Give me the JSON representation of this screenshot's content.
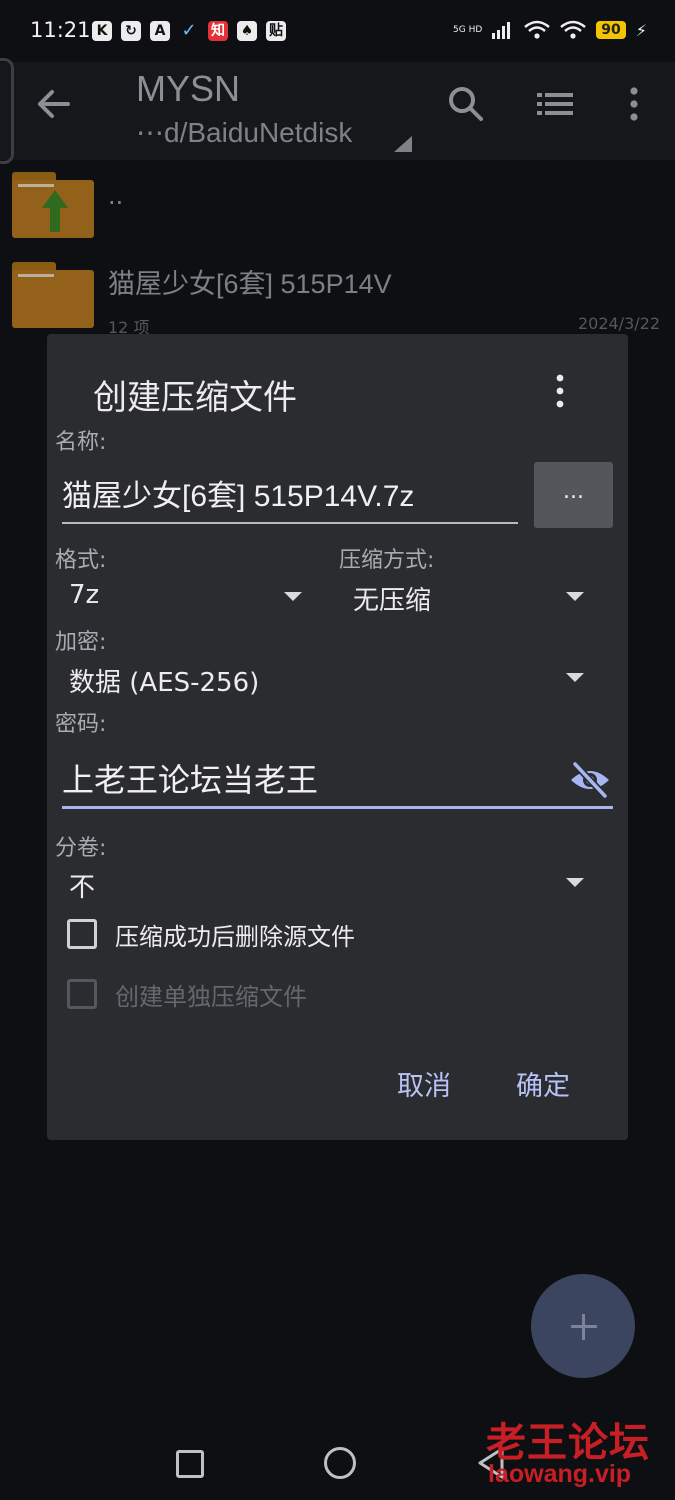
{
  "status_bar": {
    "time": "11:21",
    "app_icons": [
      "K",
      "↻",
      "A",
      "✓",
      "知",
      "♠",
      "贴"
    ],
    "network": "5G HD",
    "battery": "90"
  },
  "toolbar": {
    "title": "MYSN",
    "path": "⋯d/BaiduNetdisk"
  },
  "files": {
    "parent_label": "..",
    "folder": {
      "name": "猫屋少女[6套] 515P14V",
      "count": "12 项",
      "date": "2024/3/22"
    }
  },
  "dialog": {
    "title": "创建压缩文件",
    "name_label": "名称:",
    "name_value": "猫屋少女[6套] 515P14V.7z",
    "browse_label": "...",
    "format_label": "格式:",
    "format_value": "7z",
    "method_label": "压缩方式:",
    "method_value": "无压缩",
    "encryption_label": "加密:",
    "encryption_value": "数据 (AES-256)",
    "password_label": "密码:",
    "password_value": "上老王论坛当老王",
    "split_label": "分卷:",
    "split_value": "不",
    "delete_source_label": "压缩成功后删除源文件",
    "separate_archives_label": "创建单独压缩文件",
    "cancel_label": "取消",
    "ok_label": "确定"
  },
  "watermark": {
    "main": "老王论坛",
    "sub": "laowang.vip"
  },
  "colors": {
    "accent": "#b7c3f6",
    "dialog_bg": "#2b2c30",
    "folder": "#93611a",
    "watermark": "#c81e25"
  }
}
